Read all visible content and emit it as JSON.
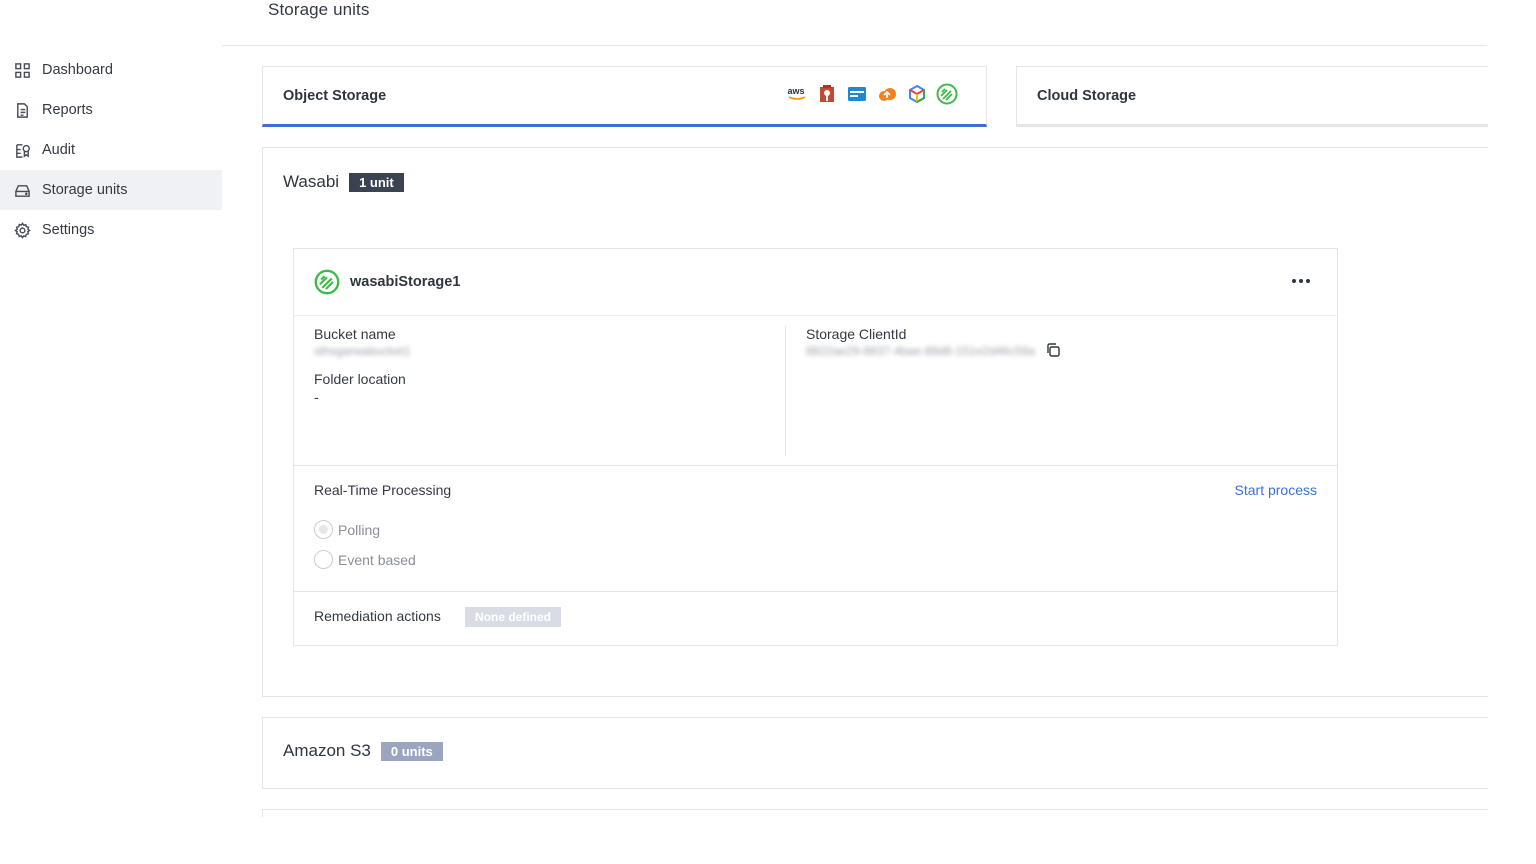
{
  "header": {
    "title": "Storage units"
  },
  "sidebar": {
    "items": [
      {
        "label": "Dashboard",
        "icon": "grid-icon",
        "active": false
      },
      {
        "label": "Reports",
        "icon": "document-icon",
        "active": false
      },
      {
        "label": "Audit",
        "icon": "audit-icon",
        "active": false
      },
      {
        "label": "Storage units",
        "icon": "storage-icon",
        "active": true
      },
      {
        "label": "Settings",
        "icon": "gear-icon",
        "active": false
      }
    ]
  },
  "tabs": {
    "object": {
      "label": "Object Storage",
      "logos": [
        "aws-logo",
        "oracle-logo",
        "azure-logo",
        "cloudflare-logo",
        "gcp-logo",
        "wasabi-logo"
      ]
    },
    "cloud": {
      "label": "Cloud Storage"
    }
  },
  "wasabi": {
    "title": "Wasabi",
    "badge": "1 unit",
    "card": {
      "name": "wasabiStorage1",
      "bucket_label": "Bucket name",
      "bucket_value": "sthsgarwabucket1",
      "folder_label": "Folder location",
      "folder_value": "-",
      "client_label": "Storage ClientId",
      "client_value": "8822ae29-8837-4bae-88d8-151e2d46c59a",
      "rt_title": "Real-Time Processing",
      "start_label": "Start process",
      "radio_polling": "Polling",
      "radio_event": "Event based",
      "remediation_label": "Remediation actions",
      "remediation_value": "None defined"
    }
  },
  "s3": {
    "title": "Amazon S3",
    "badge": "0 units"
  },
  "colors": {
    "accent": "#3b6fd8",
    "badge_dark": "#3b4252",
    "badge_light": "#9aa5c0",
    "wasabi_green": "#3dbb4a"
  }
}
